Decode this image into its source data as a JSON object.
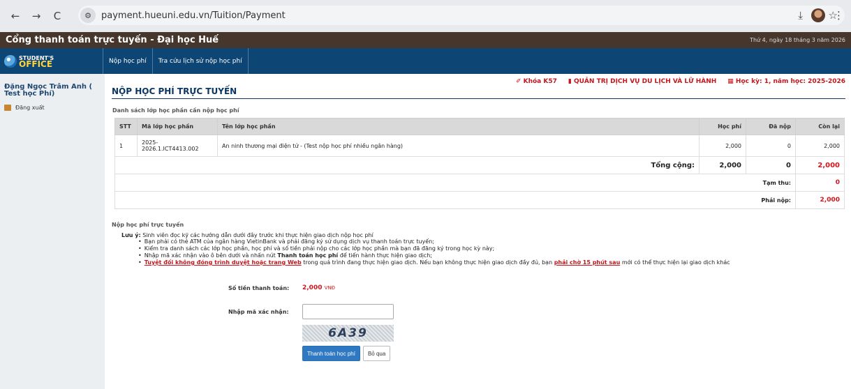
{
  "browser": {
    "url": "payment.hueuni.edu.vn/Tuition/Payment",
    "back_icon": "←",
    "forward_icon": "→",
    "reload_icon": "C",
    "zoom_icon": "⚲",
    "star_icon": "☆",
    "download_icon": "⤓",
    "menu_icon": "⋮"
  },
  "header": {
    "app_title": "Cổng thanh toán trực tuyến - Đại học Huế",
    "date": "Thứ 4, ngày 18 tháng 3 năm 2026",
    "logo_line1": "STUDENT'S",
    "logo_line2": "OFFICE"
  },
  "menu": [
    {
      "label": "Nộp học phí"
    },
    {
      "label": "Tra cứu lịch sử nộp học phí"
    }
  ],
  "sidebar": {
    "user": "Đặng Ngọc Trâm Anh ( Test học Phí)",
    "logout": "Đăng xuất"
  },
  "meta": {
    "course": "✐ Khóa K57",
    "major": "▮ QUẢN TRỊ DỊCH VỤ DU LỊCH VÀ LỮ HÀNH",
    "term": "▦ Học kỳ: 1, năm học: 2025-2026"
  },
  "page_title": "NỘP HỌC PHÍ TRỰC TUYẾN",
  "table": {
    "section_title": "Danh sách lớp học phần cần nộp học phí",
    "headers": [
      "STT",
      "Mã lớp học phần",
      "Tên lớp học phần",
      "Học phí",
      "Đã nộp",
      "Còn lại"
    ],
    "rows": [
      {
        "stt": "1",
        "code": "2025-2026.1.ICT4413.002",
        "name": "An ninh thương mại điện tử - (Test nộp học phí nhiều ngân hàng)",
        "fee": "2,000",
        "paid": "0",
        "remain": "2,000"
      }
    ],
    "total_label": "Tổng cộng:",
    "total_fee": "2,000",
    "total_paid": "0",
    "total_remain": "2,000",
    "advance_label": "Tạm thu:",
    "advance_value": "0",
    "due_label": "Phải nộp:",
    "due_value": "2,000"
  },
  "notes": {
    "section_title": "Nộp học phí trực tuyến",
    "lead_bold": "Lưu ý:",
    "lead_text": " Sinh viên đọc kỹ các hướng dẫn dưới đây trước khi thực hiện giao dịch nộp học phí",
    "item1": "Bạn phải có thẻ ATM của ngân hàng VietinBank và phải đăng ký sử dụng dịch vụ thanh toán trực tuyến;",
    "item2": "Kiểm tra danh sách các lớp học phần, học phí và số tiền phải nộp cho các lớp học phần mà bạn đã đăng ký trong học kỳ này;",
    "item3_a": "Nhập mã xác nhận vào ô bên dưới và nhấn nút ",
    "item3_b": "Thanh toán học phí",
    "item3_c": " để tiến hành thực hiện giao dịch;",
    "item4_a": "Tuyệt đối không đóng trình duyệt hoặc trang Web",
    "item4_b": " trong quá trình đang thực hiện giao dịch. Nếu bạn không thực hiện giao dịch đầy đủ, bạn ",
    "item4_c": "phải chờ 15 phút sau",
    "item4_d": " mới có thể thực hiện lại giao dịch khác"
  },
  "form": {
    "amount_label": "Số tiền thanh toán:",
    "amount_value": "2,000",
    "amount_unit": "VNĐ",
    "code_label": "Nhập mã xác nhận:",
    "code_value": "",
    "captcha": "6A39",
    "submit": "Thanh toán học phí",
    "cancel": "Bỏ qua"
  }
}
